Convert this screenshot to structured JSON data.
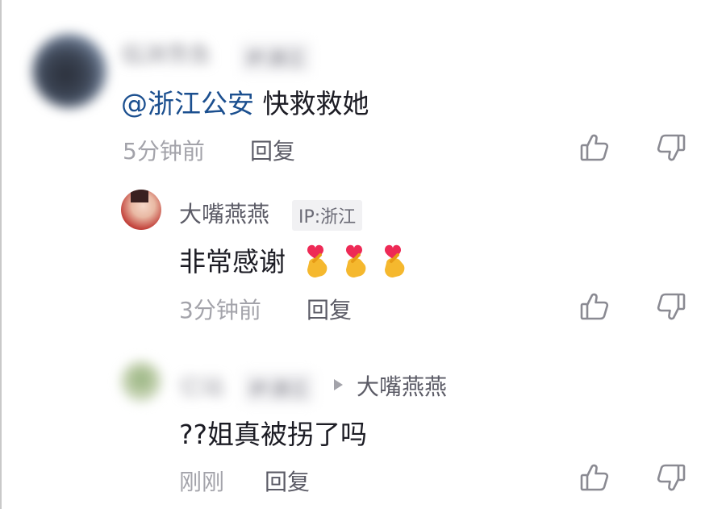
{
  "comments": [
    {
      "username": "临渊羡鱼",
      "ip": "IP:浙江",
      "mention": "@浙江公安",
      "text": " 快救救她",
      "time": "5分钟前",
      "reply_label": "回复"
    },
    {
      "username": "大嘴燕燕",
      "ip": "IP:浙江",
      "text": "非常感谢",
      "emoji": [
        "finger-heart-emoji",
        "finger-heart-emoji",
        "finger-heart-emoji"
      ],
      "time": "3分钟前",
      "reply_label": "回复"
    },
    {
      "username": "亿站",
      "ip": "IP:浙江",
      "reply_to": "大嘴燕燕",
      "text": "??姐真被拐了吗",
      "time": "刚刚",
      "reply_label": "回复"
    }
  ],
  "colors": {
    "mention": "#1b4f8f",
    "text": "#1c1c24",
    "muted": "#a3a3aa"
  }
}
